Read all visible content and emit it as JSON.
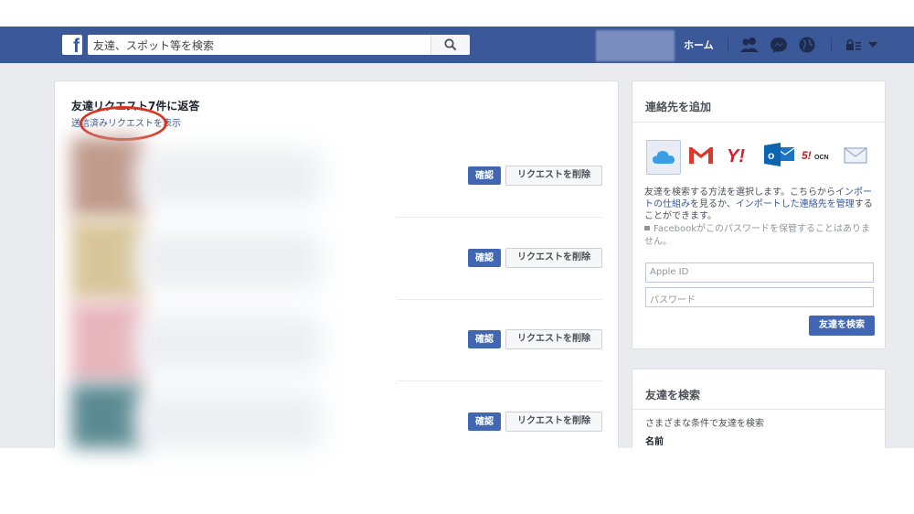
{
  "topbar": {
    "logo": "f",
    "search_placeholder": "友達、スポット等を検索",
    "home_label": "ホーム",
    "icons": [
      "friends-icon",
      "messenger-icon",
      "globe-icon",
      "privacy-lock-icon",
      "dropdown-arrow-icon"
    ]
  },
  "friend_requests": {
    "title": "友達リクエスト7件に返答",
    "sent_link": "送信済みリクエストを表示",
    "confirm_label": "確認",
    "delete_label": "リクエストを削除",
    "rows": [
      {
        "photo_color": "#c09a8c"
      },
      {
        "photo_color": "#d8c69a"
      },
      {
        "photo_color": "#e8b6bd"
      },
      {
        "photo_color": "#5b8a92"
      }
    ]
  },
  "add_contacts": {
    "title": "連絡先を追加",
    "services": [
      "icloud-icon",
      "gmail-icon",
      "yahoo-icon",
      "outlook-icon",
      "ocn-icon",
      "mail-icon"
    ],
    "desc_1": "友達を検索する方法を選択します。こちらから",
    "desc_link_1": "インポートの仕組み",
    "desc_2": "を見るか、",
    "desc_link_2": "インポートした連絡先を管理",
    "desc_3": "することができます。",
    "note": "Facebookがこのパスワードを保管することはありません。",
    "apple_id_placeholder": "Apple ID",
    "password_placeholder": "パスワード",
    "find_button": "友達を検索"
  },
  "find_friends": {
    "title": "友達を検索",
    "desc": "さまざまな条件で友達を検索",
    "name_label": "名前"
  },
  "colors": {
    "facebook_blue": "#3b5998",
    "button_blue": "#4267b2",
    "annotation_red": "#d93321"
  }
}
